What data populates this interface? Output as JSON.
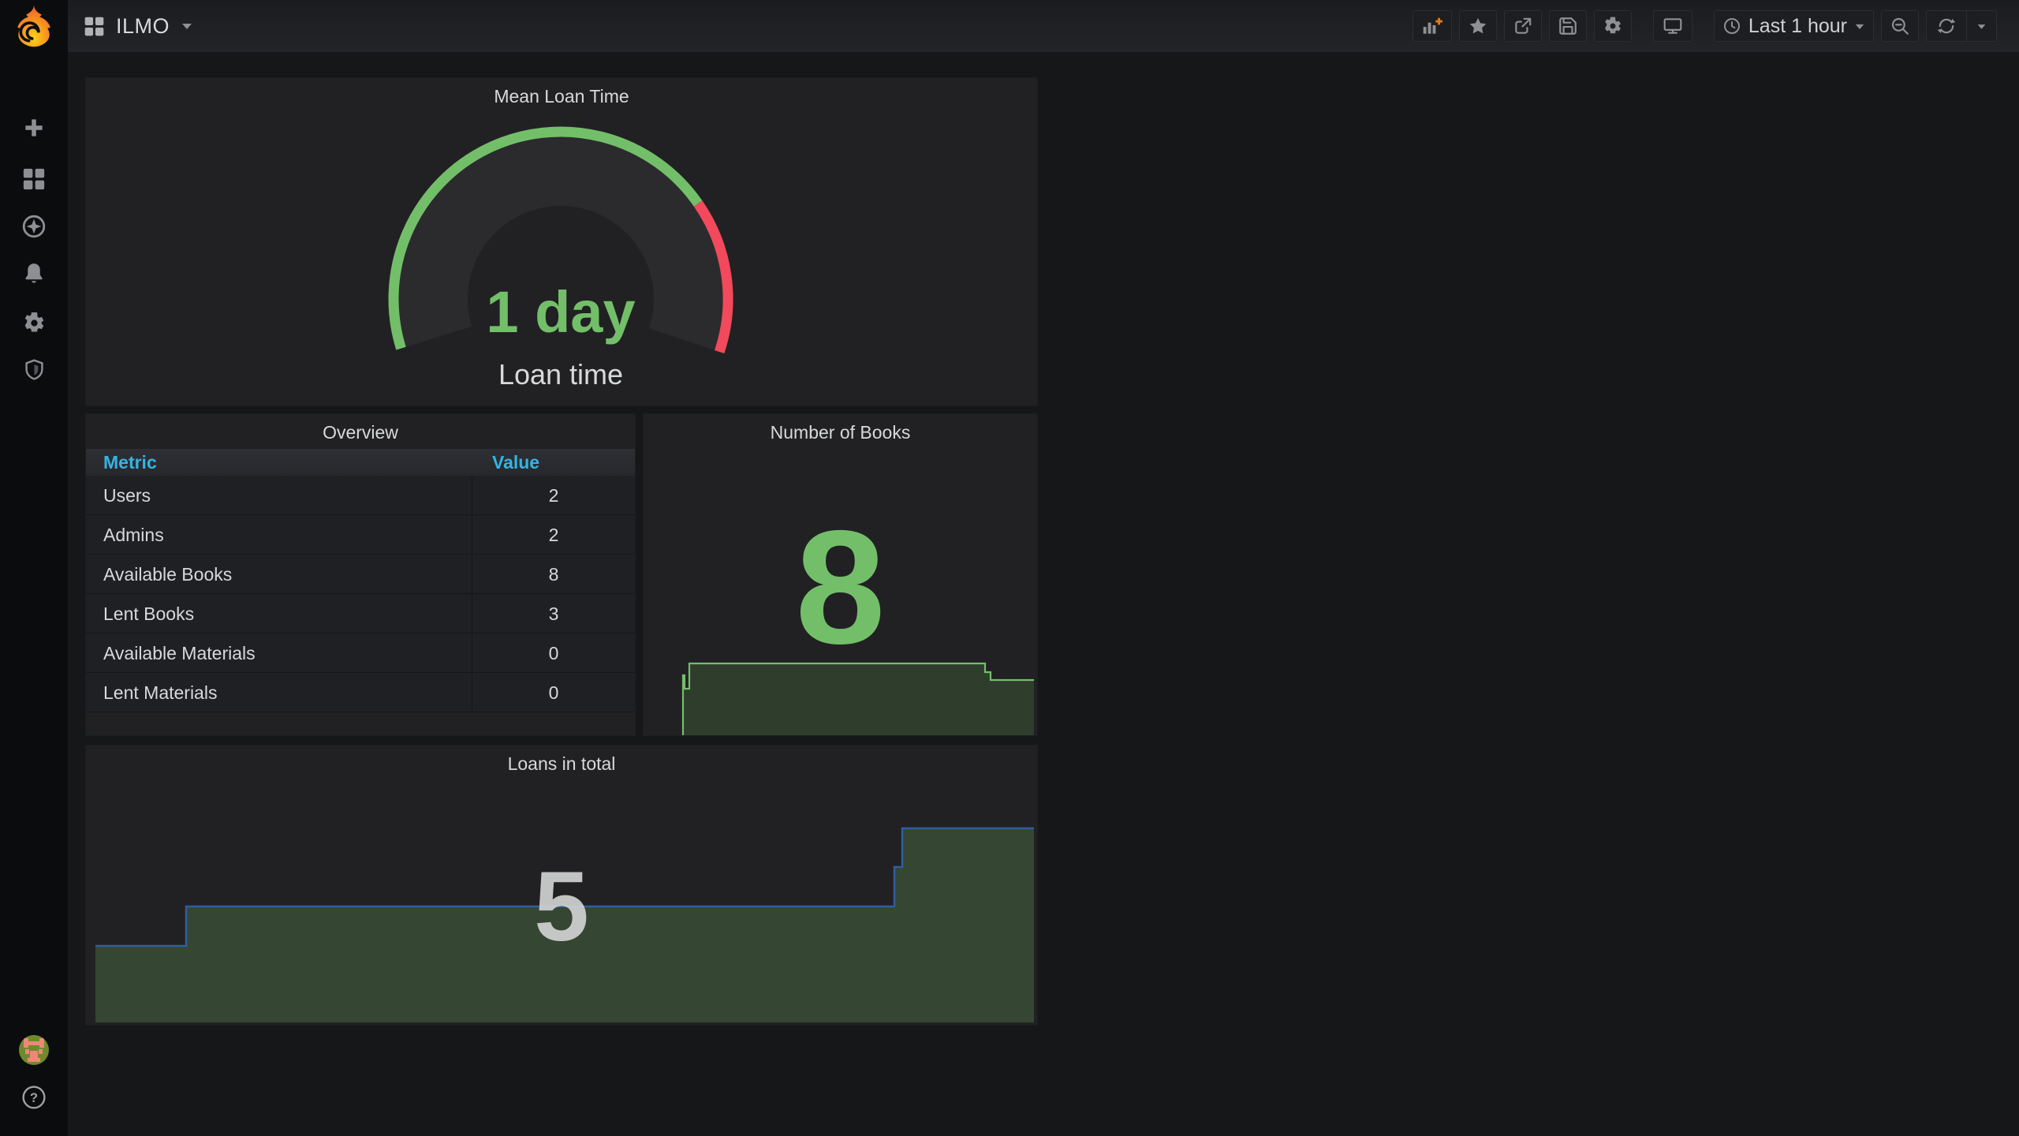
{
  "navbar": {
    "title": "ILMO",
    "time_picker": {
      "label": "Last 1 hour",
      "icon": "clock-icon"
    },
    "toolbar_icons": [
      "add-panel-icon",
      "star-icon",
      "share-icon",
      "save-icon",
      "gear-icon",
      "tv-icon",
      "zoom-out-icon",
      "refresh-icon",
      "chevron-down-icon"
    ]
  },
  "sidebar": {
    "icons": [
      "plus-icon",
      "apps-grid-icon",
      "compass-icon",
      "bell-icon",
      "gear-icon",
      "shield-icon"
    ],
    "bottom_icons": [
      "user-avatar",
      "help-icon"
    ],
    "help_glyph": "?"
  },
  "panels": {
    "gauge": {
      "title": "Mean Loan Time",
      "value": "1 day",
      "label": "Loan time"
    },
    "overview": {
      "title": "Overview",
      "columns": [
        "Metric",
        "Value"
      ],
      "rows": [
        {
          "metric": "Users",
          "value": "2"
        },
        {
          "metric": "Admins",
          "value": "2"
        },
        {
          "metric": "Available Books",
          "value": "8"
        },
        {
          "metric": "Lent Books",
          "value": "3"
        },
        {
          "metric": "Available Materials",
          "value": "0"
        },
        {
          "metric": "Lent Materials",
          "value": "0"
        }
      ]
    },
    "books": {
      "title": "Number of Books",
      "value": "8"
    },
    "loans": {
      "title": "Loans in total",
      "value": "5"
    }
  },
  "chart_data": [
    {
      "type": "gauge",
      "title": "Mean Loan Time",
      "value_text": "1 day",
      "value_label": "Loan time",
      "arc_degrees": 216,
      "segments": [
        {
          "color": "#73bf69",
          "sweep_fraction": 0.75
        },
        {
          "color": "#f2495c",
          "sweep_fraction": 0.25
        }
      ]
    },
    {
      "type": "table",
      "title": "Overview",
      "columns": [
        "Metric",
        "Value"
      ],
      "rows": [
        [
          "Users",
          2
        ],
        [
          "Admins",
          2
        ],
        [
          "Available Books",
          8
        ],
        [
          "Lent Books",
          3
        ],
        [
          "Available Materials",
          0
        ],
        [
          "Lent Materials",
          0
        ]
      ]
    },
    {
      "type": "area",
      "title": "Number of Books",
      "stat_value": 8,
      "x_range": "last 1 hour (no axis labels shown)",
      "approx_steps": [
        {
          "value": 0,
          "to_x_fraction": 0.1
        },
        {
          "value": 7,
          "to_x_fraction": 0.104
        },
        {
          "value": 5,
          "to_x_fraction": 0.116
        },
        {
          "value": 8,
          "to_x_fraction": 0.865
        },
        {
          "value": 6,
          "to_x_fraction": 1.0
        }
      ],
      "line_color": "#73bf69",
      "fill_color": "#2f3d2d",
      "grid": false,
      "legend": false
    },
    {
      "type": "area",
      "title": "Loans in total",
      "stat_value": 5,
      "x_range": "last 1 hour (no axis labels shown)",
      "approx_steps": [
        {
          "value": 2,
          "to_x_fraction": 0.105
        },
        {
          "value": 3,
          "to_x_fraction": 0.85
        },
        {
          "value": 4,
          "to_x_fraction": 0.86
        },
        {
          "value": 5,
          "to_x_fraction": 1.0
        }
      ],
      "line_color": "#2f5e9e",
      "fill_color": "#354632",
      "grid": false,
      "legend": false
    }
  ],
  "colors": {
    "green": "#73bf69",
    "red": "#f2495c",
    "blue": "#2f5e9e",
    "books_fill": "#2f3d2d",
    "loans_fill": "#354632",
    "header_blue": "#33b5e5",
    "orange": "#eb7b18",
    "stat_gray": "#d8d9da"
  }
}
